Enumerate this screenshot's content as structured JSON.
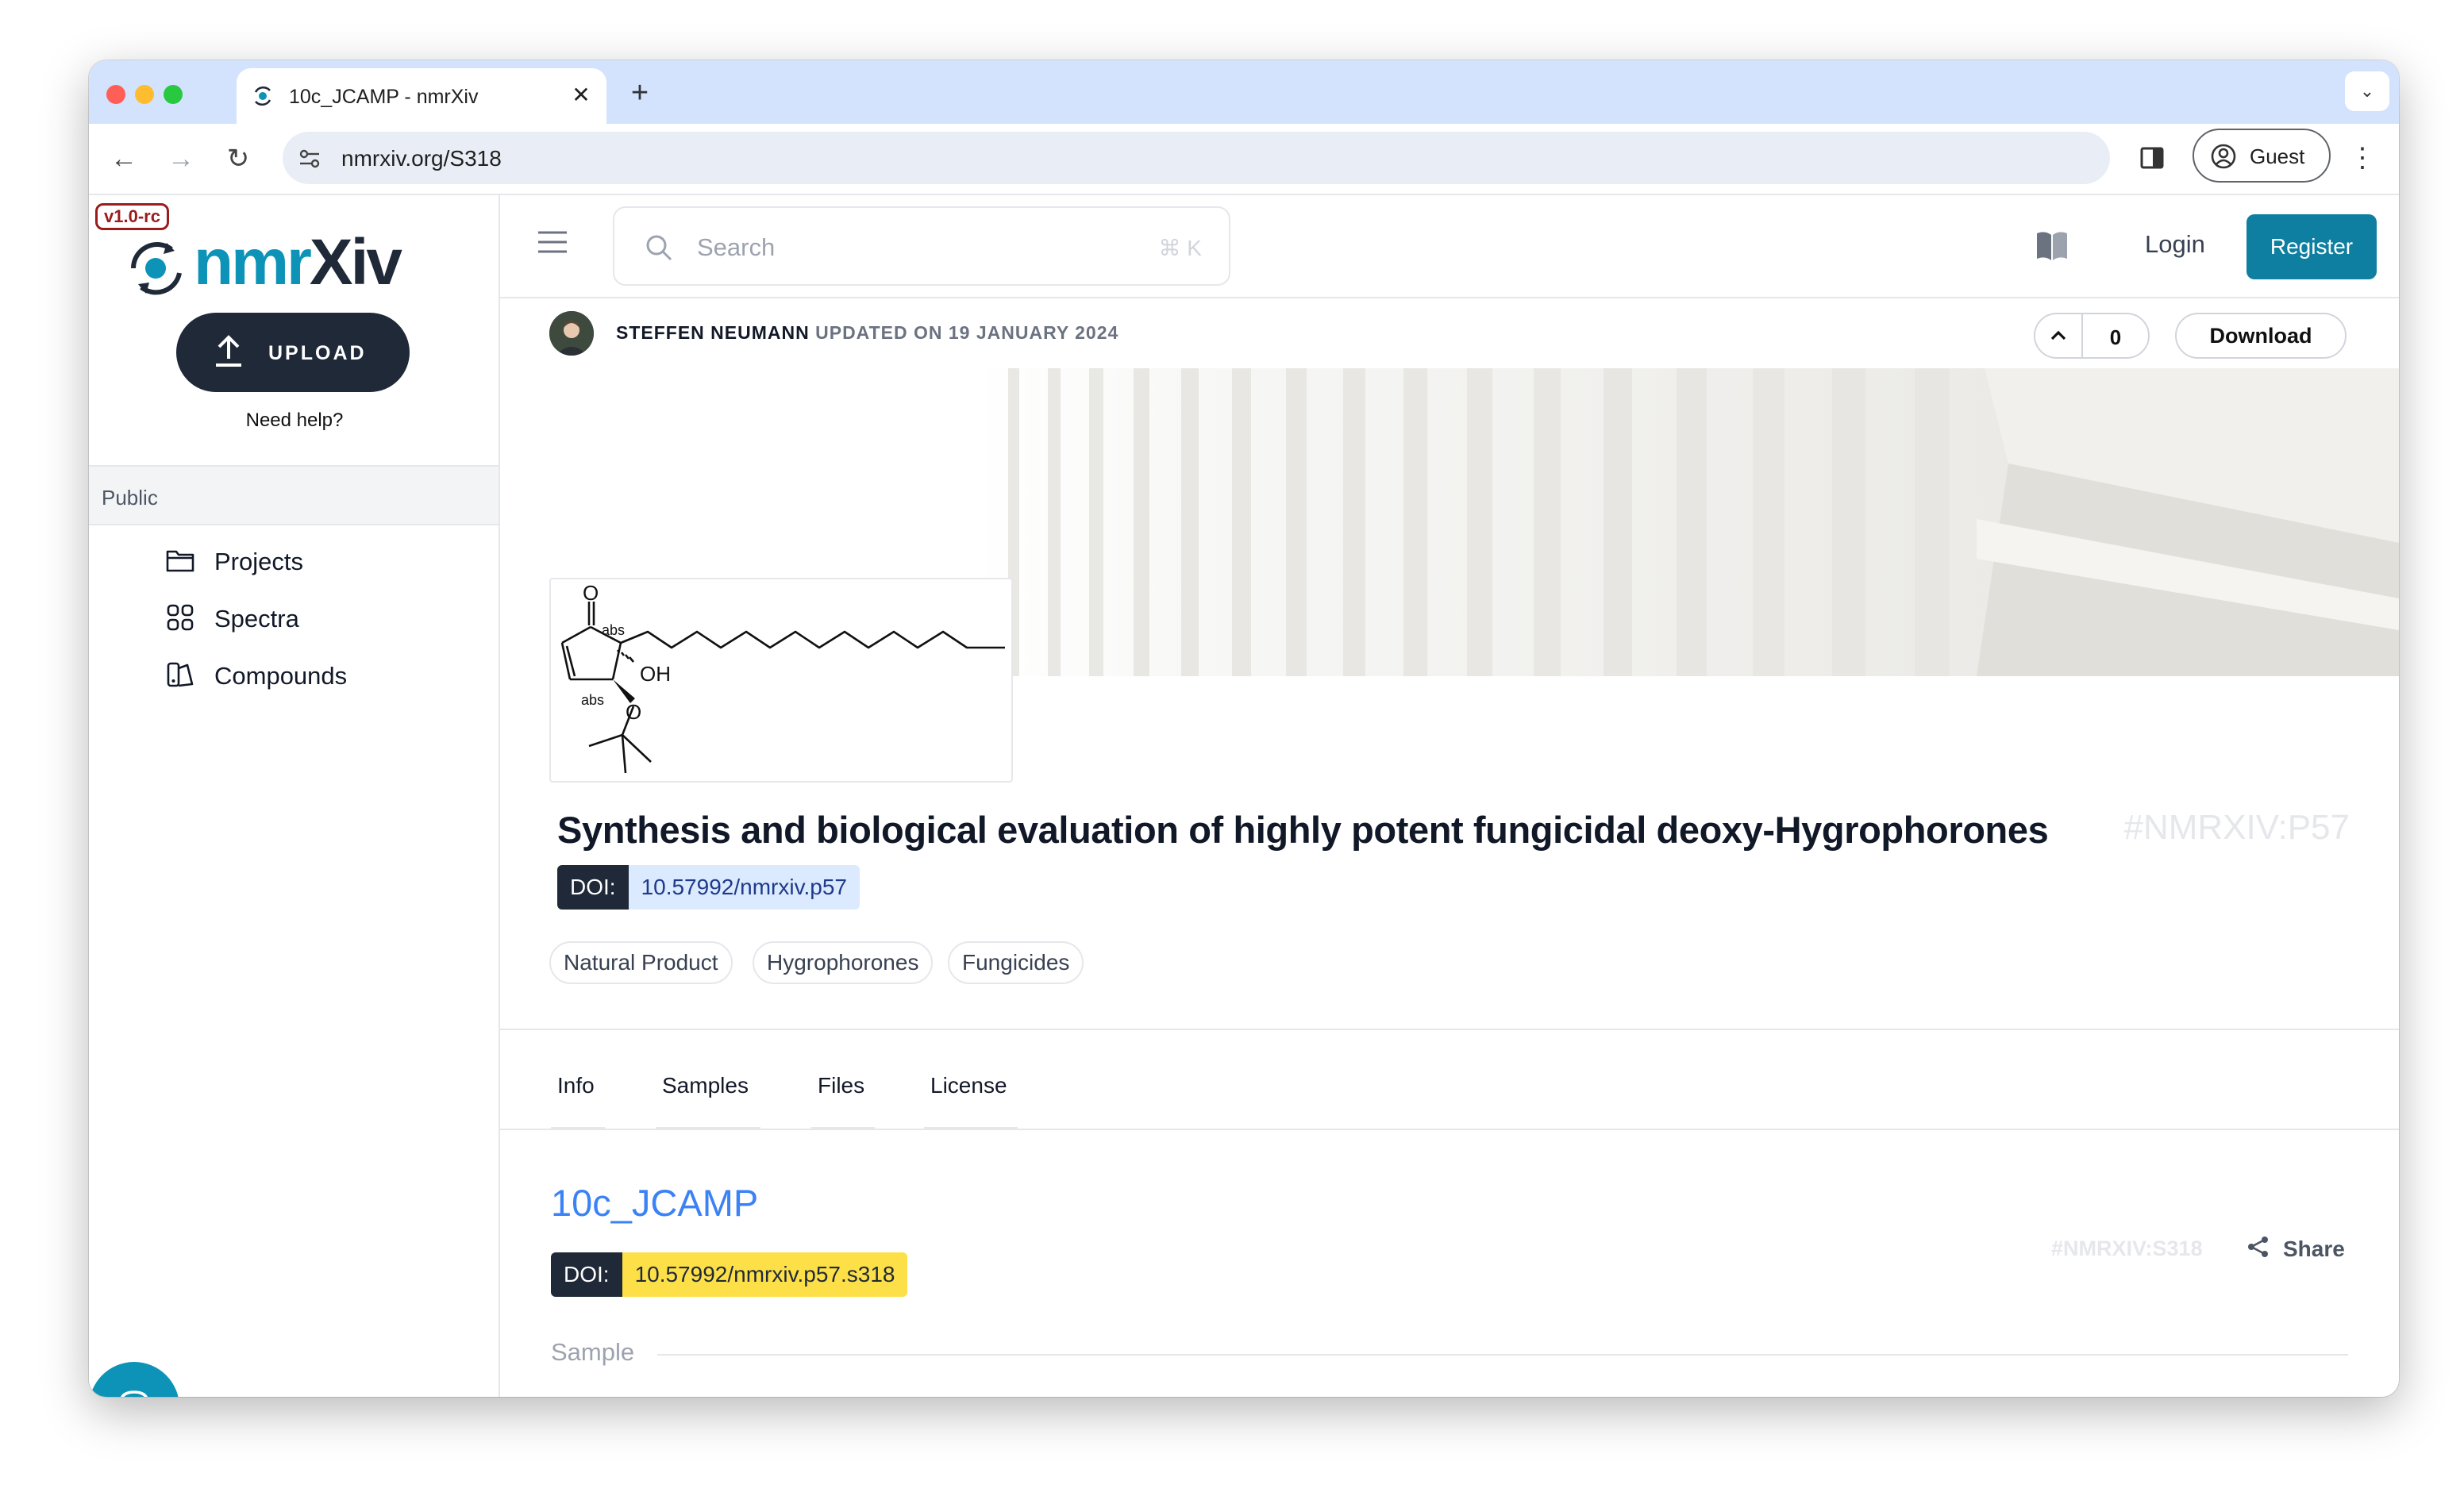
{
  "browser": {
    "tab_title": "10c_JCAMP - nmrXiv",
    "url": "nmrxiv.org/S318",
    "profile_label": "Guest"
  },
  "sidebar": {
    "version_badge": "v1.0-rc",
    "logo_part1": "nmr",
    "logo_part2": "Xiv",
    "upload_label": "UPLOAD",
    "need_help": "Need help?",
    "section_label": "Public",
    "items": [
      {
        "label": "Projects",
        "icon": "folder-icon"
      },
      {
        "label": "Spectra",
        "icon": "grid-icon"
      },
      {
        "label": "Compounds",
        "icon": "compounds-icon"
      }
    ]
  },
  "header": {
    "search_placeholder": "Search",
    "search_shortcut": "⌘ K",
    "login_label": "Login",
    "register_label": "Register"
  },
  "project": {
    "author": "STEFFEN NEUMANN",
    "updated_text": "UPDATED ON 19 JANUARY 2024",
    "vote_count": "0",
    "download_label": "Download",
    "title": "Synthesis and biological evaluation of highly potent fungicidal deoxy-Hygrophorones",
    "identifier": "#NMRXIV:P57",
    "doi_label": "DOI:",
    "doi_value": "10.57992/nmrxiv.p57",
    "keywords": [
      "Natural Product",
      "Hygrophorones",
      "Fungicides"
    ],
    "molecule_labels": {
      "oxygen_top": "O",
      "abs_1": "abs",
      "hydroxyl": "OH",
      "abs_2": "abs",
      "oxygen_bottom": "O"
    }
  },
  "tabs": [
    "Info",
    "Samples",
    "Files",
    "License"
  ],
  "sample": {
    "title": "10c_JCAMP",
    "identifier": "#NMRXIV:S318",
    "share_label": "Share",
    "doi_label": "DOI:",
    "doi_value": "10.57992/nmrxiv.p57.s318",
    "section_label": "Sample"
  },
  "colors": {
    "brand": "#0d93b8",
    "register_bg": "#0e7fa0",
    "dark": "#1f2937",
    "doi_project_bg": "#dbeafe",
    "doi_sample_bg": "#fde047",
    "sample_title": "#3b82f6"
  }
}
